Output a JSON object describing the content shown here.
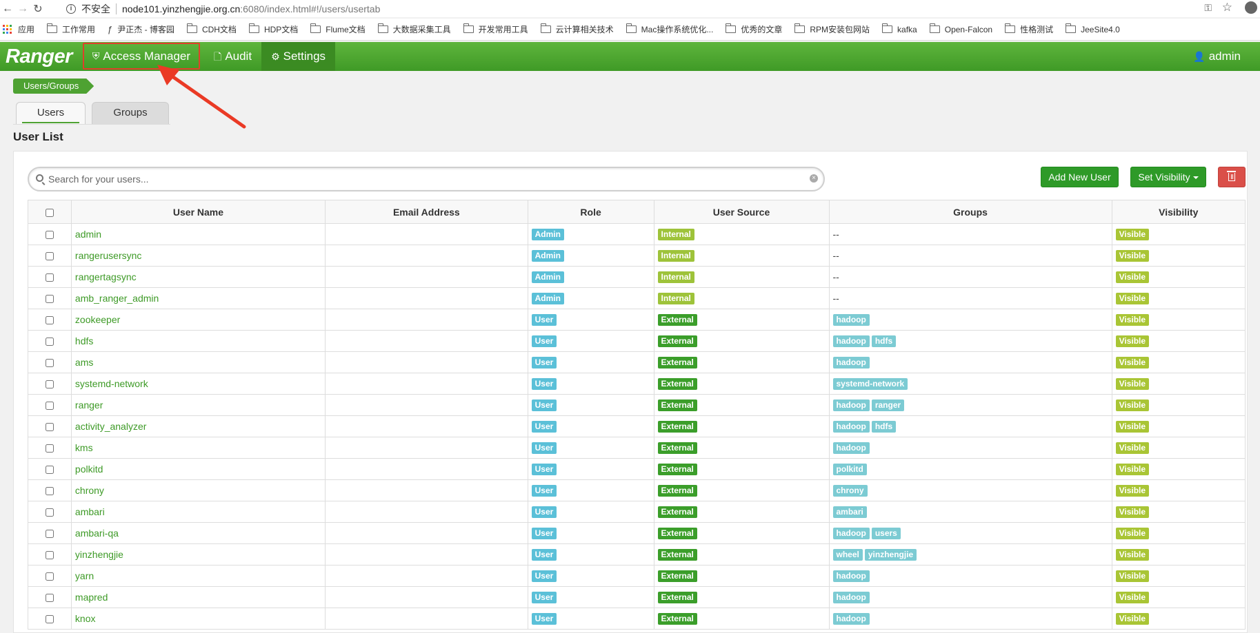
{
  "browser": {
    "insecure_label": "不安全",
    "url_host": "node101.yinzhengjie.org.cn",
    "url_rest": ":6080/index.html#!/users/usertab"
  },
  "bookmarks": [
    {
      "label": "应用",
      "icon": "apps-icon"
    },
    {
      "label": "工作常用",
      "icon": "folder-icon"
    },
    {
      "label": "尹正杰 - 博客园",
      "icon": "blog-icon"
    },
    {
      "label": "CDH文档",
      "icon": "folder-icon"
    },
    {
      "label": "HDP文档",
      "icon": "folder-icon"
    },
    {
      "label": "Flume文档",
      "icon": "folder-icon"
    },
    {
      "label": "大数据采集工具",
      "icon": "folder-icon"
    },
    {
      "label": "开发常用工具",
      "icon": "folder-icon"
    },
    {
      "label": "云计算相关技术",
      "icon": "folder-icon"
    },
    {
      "label": "Mac操作系统优化...",
      "icon": "folder-icon"
    },
    {
      "label": "优秀的文章",
      "icon": "folder-icon"
    },
    {
      "label": "RPM安装包网站",
      "icon": "folder-icon"
    },
    {
      "label": "kafka",
      "icon": "folder-icon"
    },
    {
      "label": "Open-Falcon",
      "icon": "folder-icon"
    },
    {
      "label": "性格测试",
      "icon": "folder-icon"
    },
    {
      "label": "JeeSite4.0",
      "icon": "folder-icon"
    }
  ],
  "nav": {
    "brand": "Ranger",
    "access_manager": "Access Manager",
    "audit": "Audit",
    "settings": "Settings",
    "user": "admin"
  },
  "breadcrumb": "Users/Groups",
  "tabs": {
    "users": "Users",
    "groups": "Groups"
  },
  "page_title": "User List",
  "search": {
    "placeholder": "Search for your users..."
  },
  "buttons": {
    "add_user": "Add New User",
    "set_visibility": "Set Visibility"
  },
  "columns": {
    "user_name": "User Name",
    "email": "Email Address",
    "role": "Role",
    "user_source": "User Source",
    "groups": "Groups",
    "visibility": "Visibility"
  },
  "colors": {
    "nav_green": "#4ea232",
    "highlight_red": "#e0402a",
    "link_green": "#3d9a26",
    "delete_red": "#da4f49"
  },
  "users": [
    {
      "name": "admin",
      "email": "",
      "role": "Admin",
      "source": "Internal",
      "groups": [],
      "visibility": "Visible"
    },
    {
      "name": "rangerusersync",
      "email": "",
      "role": "Admin",
      "source": "Internal",
      "groups": [],
      "visibility": "Visible"
    },
    {
      "name": "rangertagsync",
      "email": "",
      "role": "Admin",
      "source": "Internal",
      "groups": [],
      "visibility": "Visible"
    },
    {
      "name": "amb_ranger_admin",
      "email": "",
      "role": "Admin",
      "source": "Internal",
      "groups": [],
      "visibility": "Visible"
    },
    {
      "name": "zookeeper",
      "email": "",
      "role": "User",
      "source": "External",
      "groups": [
        "hadoop"
      ],
      "visibility": "Visible"
    },
    {
      "name": "hdfs",
      "email": "",
      "role": "User",
      "source": "External",
      "groups": [
        "hadoop",
        "hdfs"
      ],
      "visibility": "Visible"
    },
    {
      "name": "ams",
      "email": "",
      "role": "User",
      "source": "External",
      "groups": [
        "hadoop"
      ],
      "visibility": "Visible"
    },
    {
      "name": "systemd-network",
      "email": "",
      "role": "User",
      "source": "External",
      "groups": [
        "systemd-network"
      ],
      "visibility": "Visible"
    },
    {
      "name": "ranger",
      "email": "",
      "role": "User",
      "source": "External",
      "groups": [
        "hadoop",
        "ranger"
      ],
      "visibility": "Visible"
    },
    {
      "name": "activity_analyzer",
      "email": "",
      "role": "User",
      "source": "External",
      "groups": [
        "hadoop",
        "hdfs"
      ],
      "visibility": "Visible"
    },
    {
      "name": "kms",
      "email": "",
      "role": "User",
      "source": "External",
      "groups": [
        "hadoop"
      ],
      "visibility": "Visible"
    },
    {
      "name": "polkitd",
      "email": "",
      "role": "User",
      "source": "External",
      "groups": [
        "polkitd"
      ],
      "visibility": "Visible"
    },
    {
      "name": "chrony",
      "email": "",
      "role": "User",
      "source": "External",
      "groups": [
        "chrony"
      ],
      "visibility": "Visible"
    },
    {
      "name": "ambari",
      "email": "",
      "role": "User",
      "source": "External",
      "groups": [
        "ambari"
      ],
      "visibility": "Visible"
    },
    {
      "name": "ambari-qa",
      "email": "",
      "role": "User",
      "source": "External",
      "groups": [
        "hadoop",
        "users"
      ],
      "visibility": "Visible"
    },
    {
      "name": "yinzhengjie",
      "email": "",
      "role": "User",
      "source": "External",
      "groups": [
        "wheel",
        "yinzhengjie"
      ],
      "visibility": "Visible"
    },
    {
      "name": "yarn",
      "email": "",
      "role": "User",
      "source": "External",
      "groups": [
        "hadoop"
      ],
      "visibility": "Visible"
    },
    {
      "name": "mapred",
      "email": "",
      "role": "User",
      "source": "External",
      "groups": [
        "hadoop"
      ],
      "visibility": "Visible"
    },
    {
      "name": "knox",
      "email": "",
      "role": "User",
      "source": "External",
      "groups": [
        "hadoop"
      ],
      "visibility": "Visible"
    }
  ],
  "empty_groups_text": "--"
}
